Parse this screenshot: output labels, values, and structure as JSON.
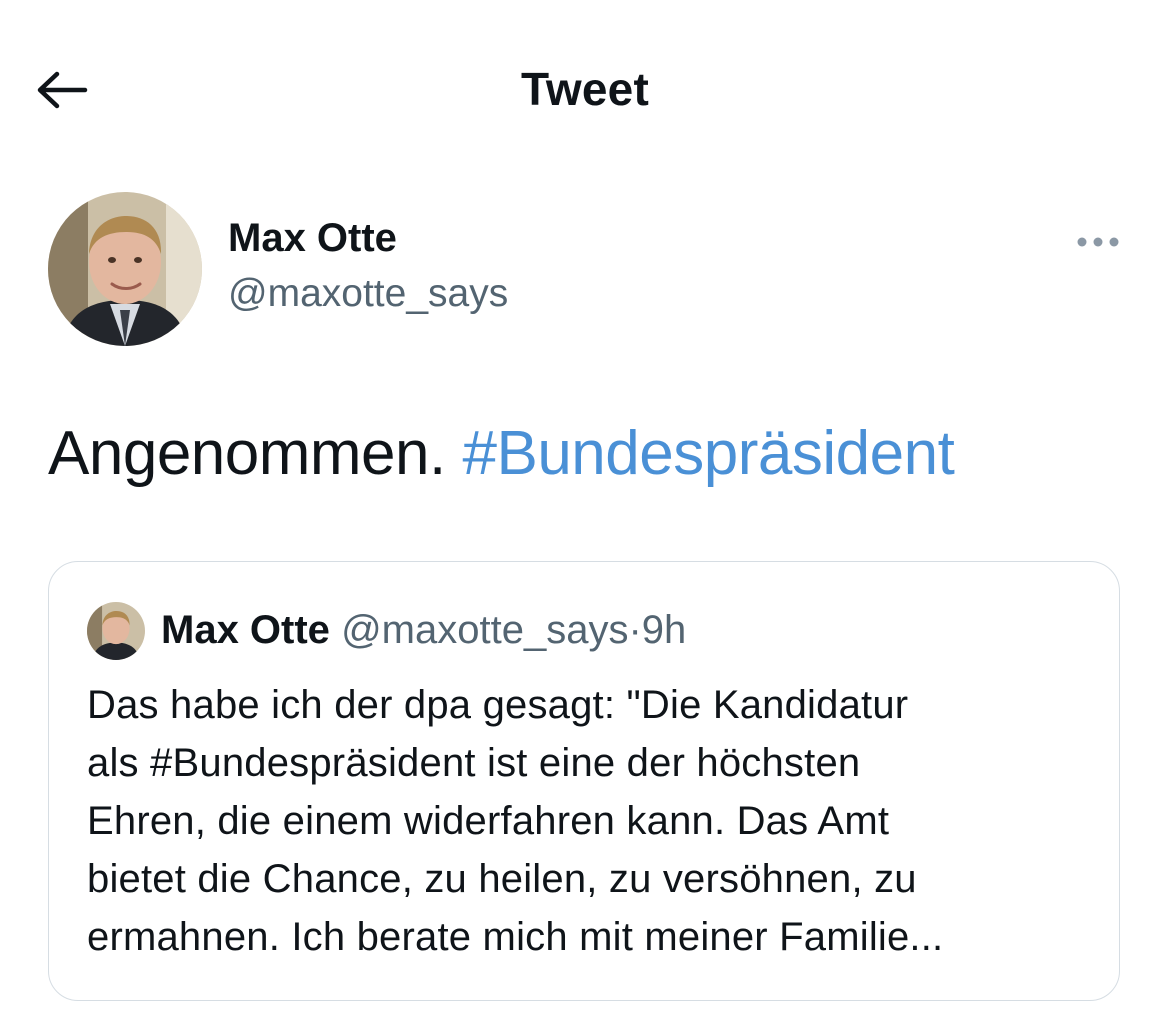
{
  "header": {
    "back_icon": "arrow-left-icon",
    "title": "Tweet"
  },
  "author": {
    "name": "Max Otte",
    "handle": "@maxotte_says",
    "avatar_icon": "avatar"
  },
  "more_icon": "more-horizontal-icon",
  "tweet": {
    "text": "Angenommen.",
    "hashtag": "#Bundespräsident"
  },
  "quote": {
    "name": "Max Otte",
    "handle": "@maxotte_says",
    "separator": "·",
    "time": "9h",
    "lines": [
      "Das habe ich der dpa gesagt: \"Die Kandidatur",
      "als #Bundespräsident ist eine der höchsten",
      "Ehren, die einem widerfahren kann. Das Amt",
      "bietet die Chance, zu heilen, zu versöhnen, zu",
      "ermahnen. Ich berate mich mit meiner Familie..."
    ]
  },
  "colors": {
    "text": "#0f1419",
    "secondary": "#536471",
    "link": "#4a90d6",
    "border": "#d6dde3"
  }
}
